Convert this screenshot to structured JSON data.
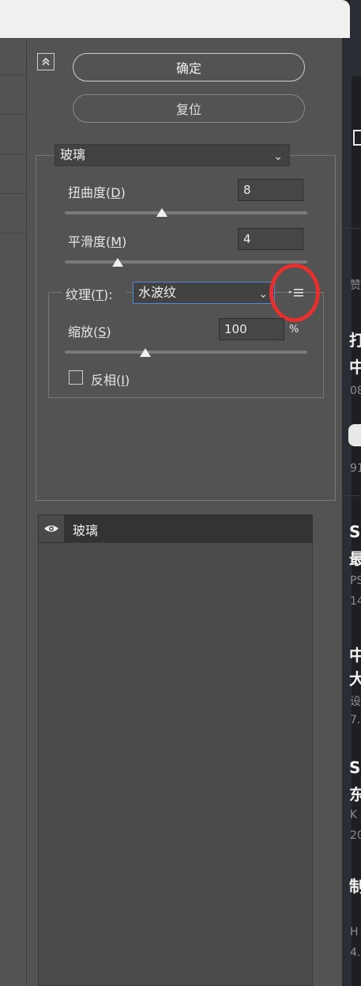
{
  "buttons": {
    "ok_label": "确定",
    "reset_label": "复位"
  },
  "filter": {
    "selected": "玻璃"
  },
  "distortion": {
    "label_text": "扭曲度(",
    "label_key": "D",
    "label_end": ")",
    "value": "8",
    "level": 8
  },
  "smoothness": {
    "label_text": "平滑度(",
    "label_key": "M",
    "label_end": ")",
    "value": "4",
    "level": 4
  },
  "texture": {
    "label_text": "纹理(",
    "label_key": "T",
    "label_end": "):",
    "selected": "水波纹"
  },
  "scaling": {
    "label_text": "缩放(",
    "label_key": "S",
    "label_end": ")",
    "value": "100",
    "unit": "%"
  },
  "invert": {
    "label_text": "反相(",
    "label_key": "I",
    "label_end": ")",
    "checked": false
  },
  "layers": [
    {
      "name": "玻璃",
      "visible": true
    }
  ],
  "right_page_fragments": {
    "t1": "打",
    "t2": "中",
    "n1": "08",
    "n2": "91",
    "a1": "赞",
    "s1": "S",
    "s2": "最",
    "g1": "PS",
    "g2": "14",
    "s3": "中文",
    "s4": "大",
    "g3": "设",
    "g4": "7.",
    "s5": "S",
    "s6": "东",
    "g5": "K",
    "g6": "20",
    "s7": "制",
    "g7": "H",
    "g8": "4."
  },
  "colors": {
    "annotation_circle": "#e5302d",
    "active_border": "#4f89d8",
    "panel_bg": "#535353"
  }
}
